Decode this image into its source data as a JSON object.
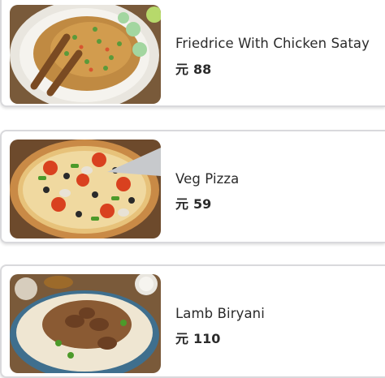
{
  "menu": {
    "currency_symbol": "元",
    "items": [
      {
        "name": "Friedrice With Chicken Satay",
        "price": "88",
        "image": "fried-rice-chicken-satay-photo"
      },
      {
        "name": "Veg Pizza",
        "price": "59",
        "image": "veg-pizza-photo"
      },
      {
        "name": "Lamb Biryani",
        "price": "110",
        "image": "lamb-biryani-photo"
      }
    ]
  }
}
